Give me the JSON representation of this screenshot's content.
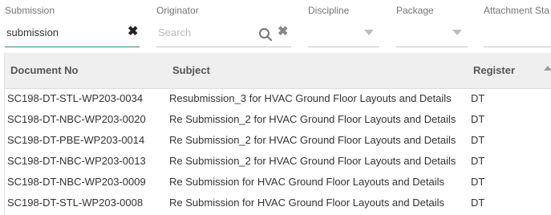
{
  "filters": {
    "submission": {
      "label": "Submission",
      "value": "submission"
    },
    "originator": {
      "label": "Originator",
      "placeholder": "Search"
    },
    "discipline": {
      "label": "Discipline",
      "value": ""
    },
    "package": {
      "label": "Package",
      "value": ""
    },
    "attachment_status": {
      "label": "Attachment Sta"
    }
  },
  "grid": {
    "columns": [
      "Document No",
      "Subject",
      "Register"
    ],
    "rows": [
      {
        "document_no": "SC198-DT-STL-WP203-0034",
        "subject": "Resubmission_3 for HVAC Ground Floor Layouts and Details",
        "register": "DT"
      },
      {
        "document_no": "SC198-DT-NBC-WP203-0020",
        "subject": "Re Submission_2 for HVAC Ground Floor Layouts and Details",
        "register": "DT"
      },
      {
        "document_no": "SC198-DT-PBE-WP203-0014",
        "subject": "Re Submission_2 for HVAC Ground Floor Layouts and Details",
        "register": "DT"
      },
      {
        "document_no": "SC198-DT-NBC-WP203-0013",
        "subject": "Re Submission_2 for HVAC Ground Floor Layouts and Details",
        "register": "DT"
      },
      {
        "document_no": "SC198-DT-NBC-WP203-0009",
        "subject": "Re Submission for HVAC Ground Floor Layouts and Details",
        "register": "DT"
      },
      {
        "document_no": "SC198-DT-STL-WP203-0008",
        "subject": "Re Submission for HVAC Ground Floor Layouts and Details",
        "register": "DT"
      }
    ]
  },
  "icons": {
    "clear": "close-icon",
    "search": "search-icon",
    "dropdown": "caret-down-icon",
    "sort": "sort-up-icon"
  },
  "colors": {
    "active_underline": "#2e8b8b",
    "header_bg": "#efefef"
  }
}
